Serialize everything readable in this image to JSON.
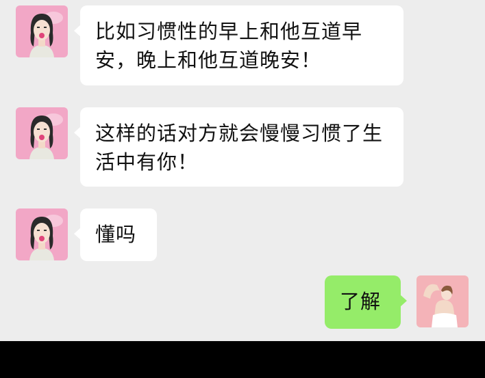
{
  "messages": [
    {
      "sender": "contact",
      "text": "比如习惯性的早上和他互道早安，晚上和他互道晚安！"
    },
    {
      "sender": "contact",
      "text": "这样的话对方就会慢慢习惯了生活中有你！"
    },
    {
      "sender": "contact",
      "text": "懂吗"
    },
    {
      "sender": "me",
      "text": "了解"
    }
  ],
  "colors": {
    "chat_background": "#ededed",
    "incoming_bubble": "#ffffff",
    "outgoing_bubble": "#95ec69",
    "contact_avatar_bg": "#f2a7c6",
    "my_avatar_bg": "#f4b3b8"
  }
}
